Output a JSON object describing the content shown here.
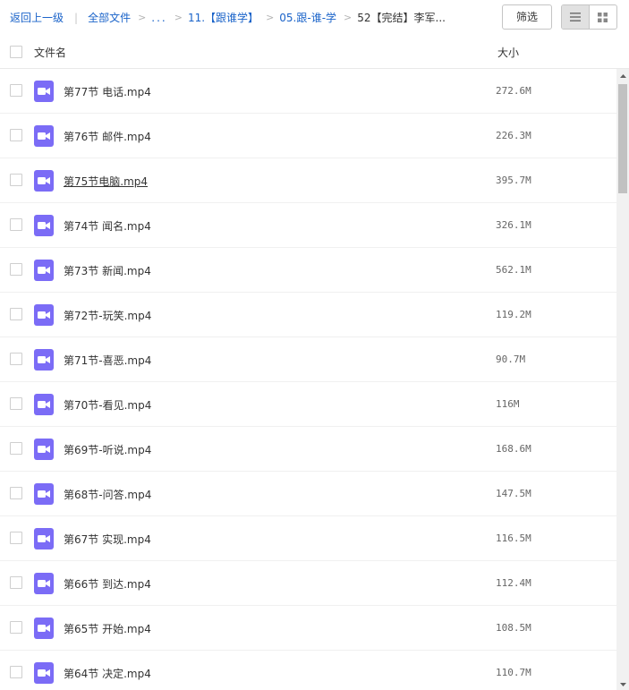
{
  "breadcrumb": {
    "back": "返回上一级",
    "root": "全部文件",
    "ellipsis": "...",
    "level1": "11.【跟谁学】",
    "level2": "05.跟-谁-学",
    "current": "52【完结】李军..."
  },
  "toolbar": {
    "filter_label": "筛选"
  },
  "header": {
    "name": "文件名",
    "size": "大小"
  },
  "files": [
    {
      "name": "第77节 电话.mp4",
      "size": "272.6M"
    },
    {
      "name": "第76节 邮件.mp4",
      "size": "226.3M"
    },
    {
      "name": "第75节电脑.mp4",
      "size": "395.7M"
    },
    {
      "name": "第74节 闻名.mp4",
      "size": "326.1M"
    },
    {
      "name": "第73节 新闻.mp4",
      "size": "562.1M"
    },
    {
      "name": "第72节-玩笑.mp4",
      "size": "119.2M"
    },
    {
      "name": "第71节-喜恶.mp4",
      "size": "90.7M"
    },
    {
      "name": "第70节-看见.mp4",
      "size": "116M"
    },
    {
      "name": "第69节-听说.mp4",
      "size": "168.6M"
    },
    {
      "name": "第68节-问答.mp4",
      "size": "147.5M"
    },
    {
      "name": "第67节 实现.mp4",
      "size": "116.5M"
    },
    {
      "name": "第66节 到达.mp4",
      "size": "112.4M"
    },
    {
      "name": "第65节 开始.mp4",
      "size": "108.5M"
    },
    {
      "name": "第64节 决定.mp4",
      "size": "110.7M"
    }
  ],
  "colors": {
    "link": "#1a63c9",
    "video_icon": "#7b6cf6"
  },
  "icons": {
    "file": "video-file-icon",
    "list_view": "list-view-icon",
    "grid_view": "grid-view-icon"
  }
}
